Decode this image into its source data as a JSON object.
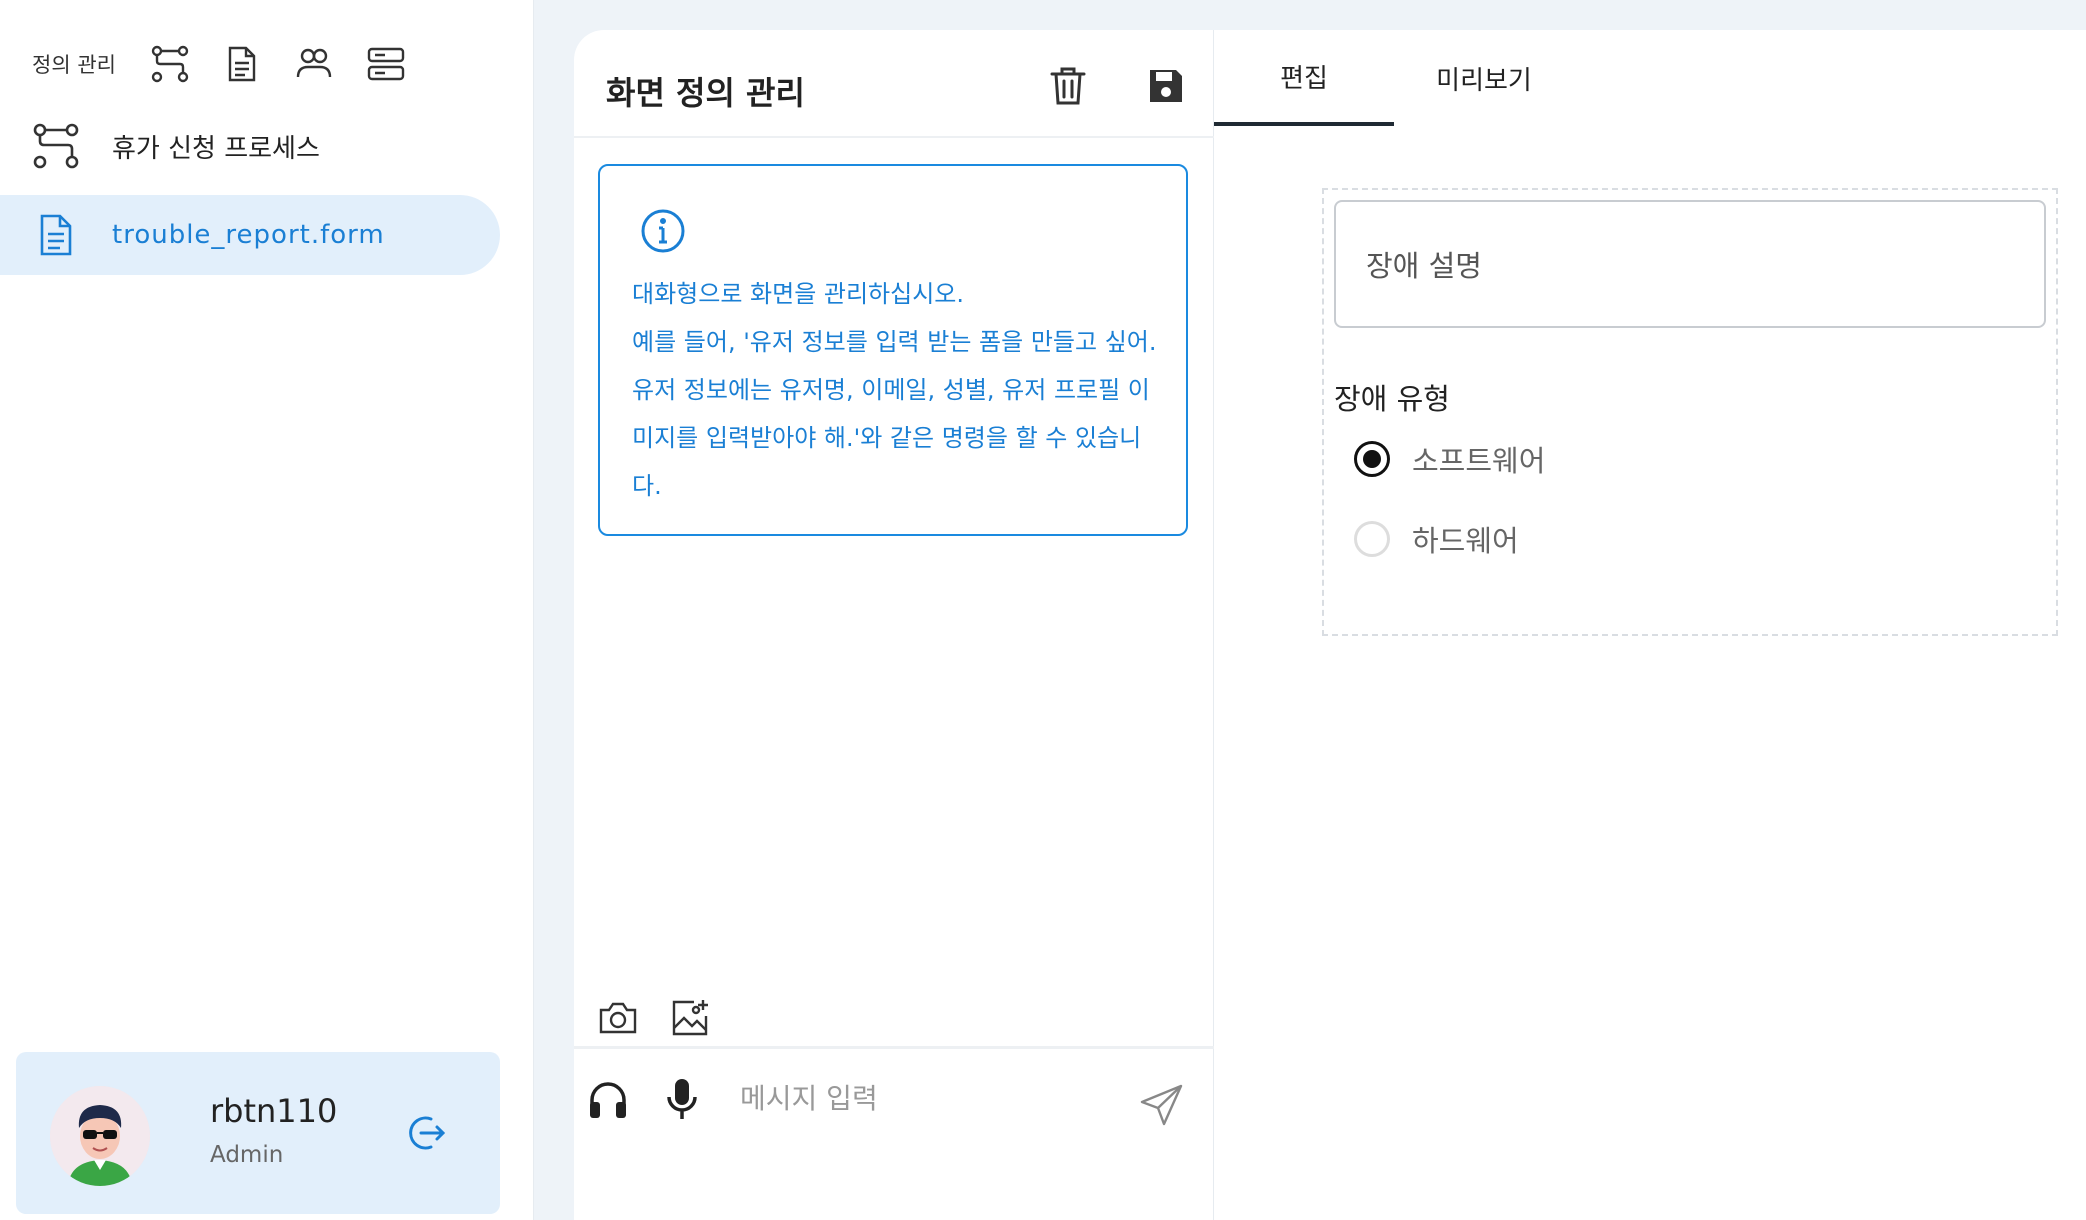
{
  "sidebar": {
    "header_title": "정의 관리",
    "items": [
      {
        "label": "휴가 신청 프로세스",
        "icon": "process-icon"
      },
      {
        "label": "trouble_report.form",
        "icon": "document-icon"
      }
    ],
    "user": {
      "name": "rbtn110",
      "role": "Admin"
    }
  },
  "chat": {
    "title": "화면 정의 관리",
    "info_lines": [
      "대화형으로 화면을 관리하십시오.",
      "예를 들어, '유저 정보를 입력 받는 폼을 만들고 싶어. 유저 정보에는 유저명, 이메일, 성별, 유저 프로필 이미지를 입력받아야 해.'와 같은 명령을 할 수 있습니다."
    ],
    "input_placeholder": "메시지 입력"
  },
  "editor": {
    "tabs": [
      {
        "label": "편집"
      },
      {
        "label": "미리보기"
      }
    ],
    "active_tab": "편집",
    "text_field_label": "장애 설명",
    "radio_group_label": "장애 유형",
    "radio_options": [
      {
        "label": "소프트웨어",
        "checked": true
      },
      {
        "label": "하드웨어",
        "checked": false
      }
    ]
  },
  "colors": {
    "accent": "#1a7fd4",
    "active_bg": "#e2effb",
    "page_bg": "#eef3f8"
  }
}
